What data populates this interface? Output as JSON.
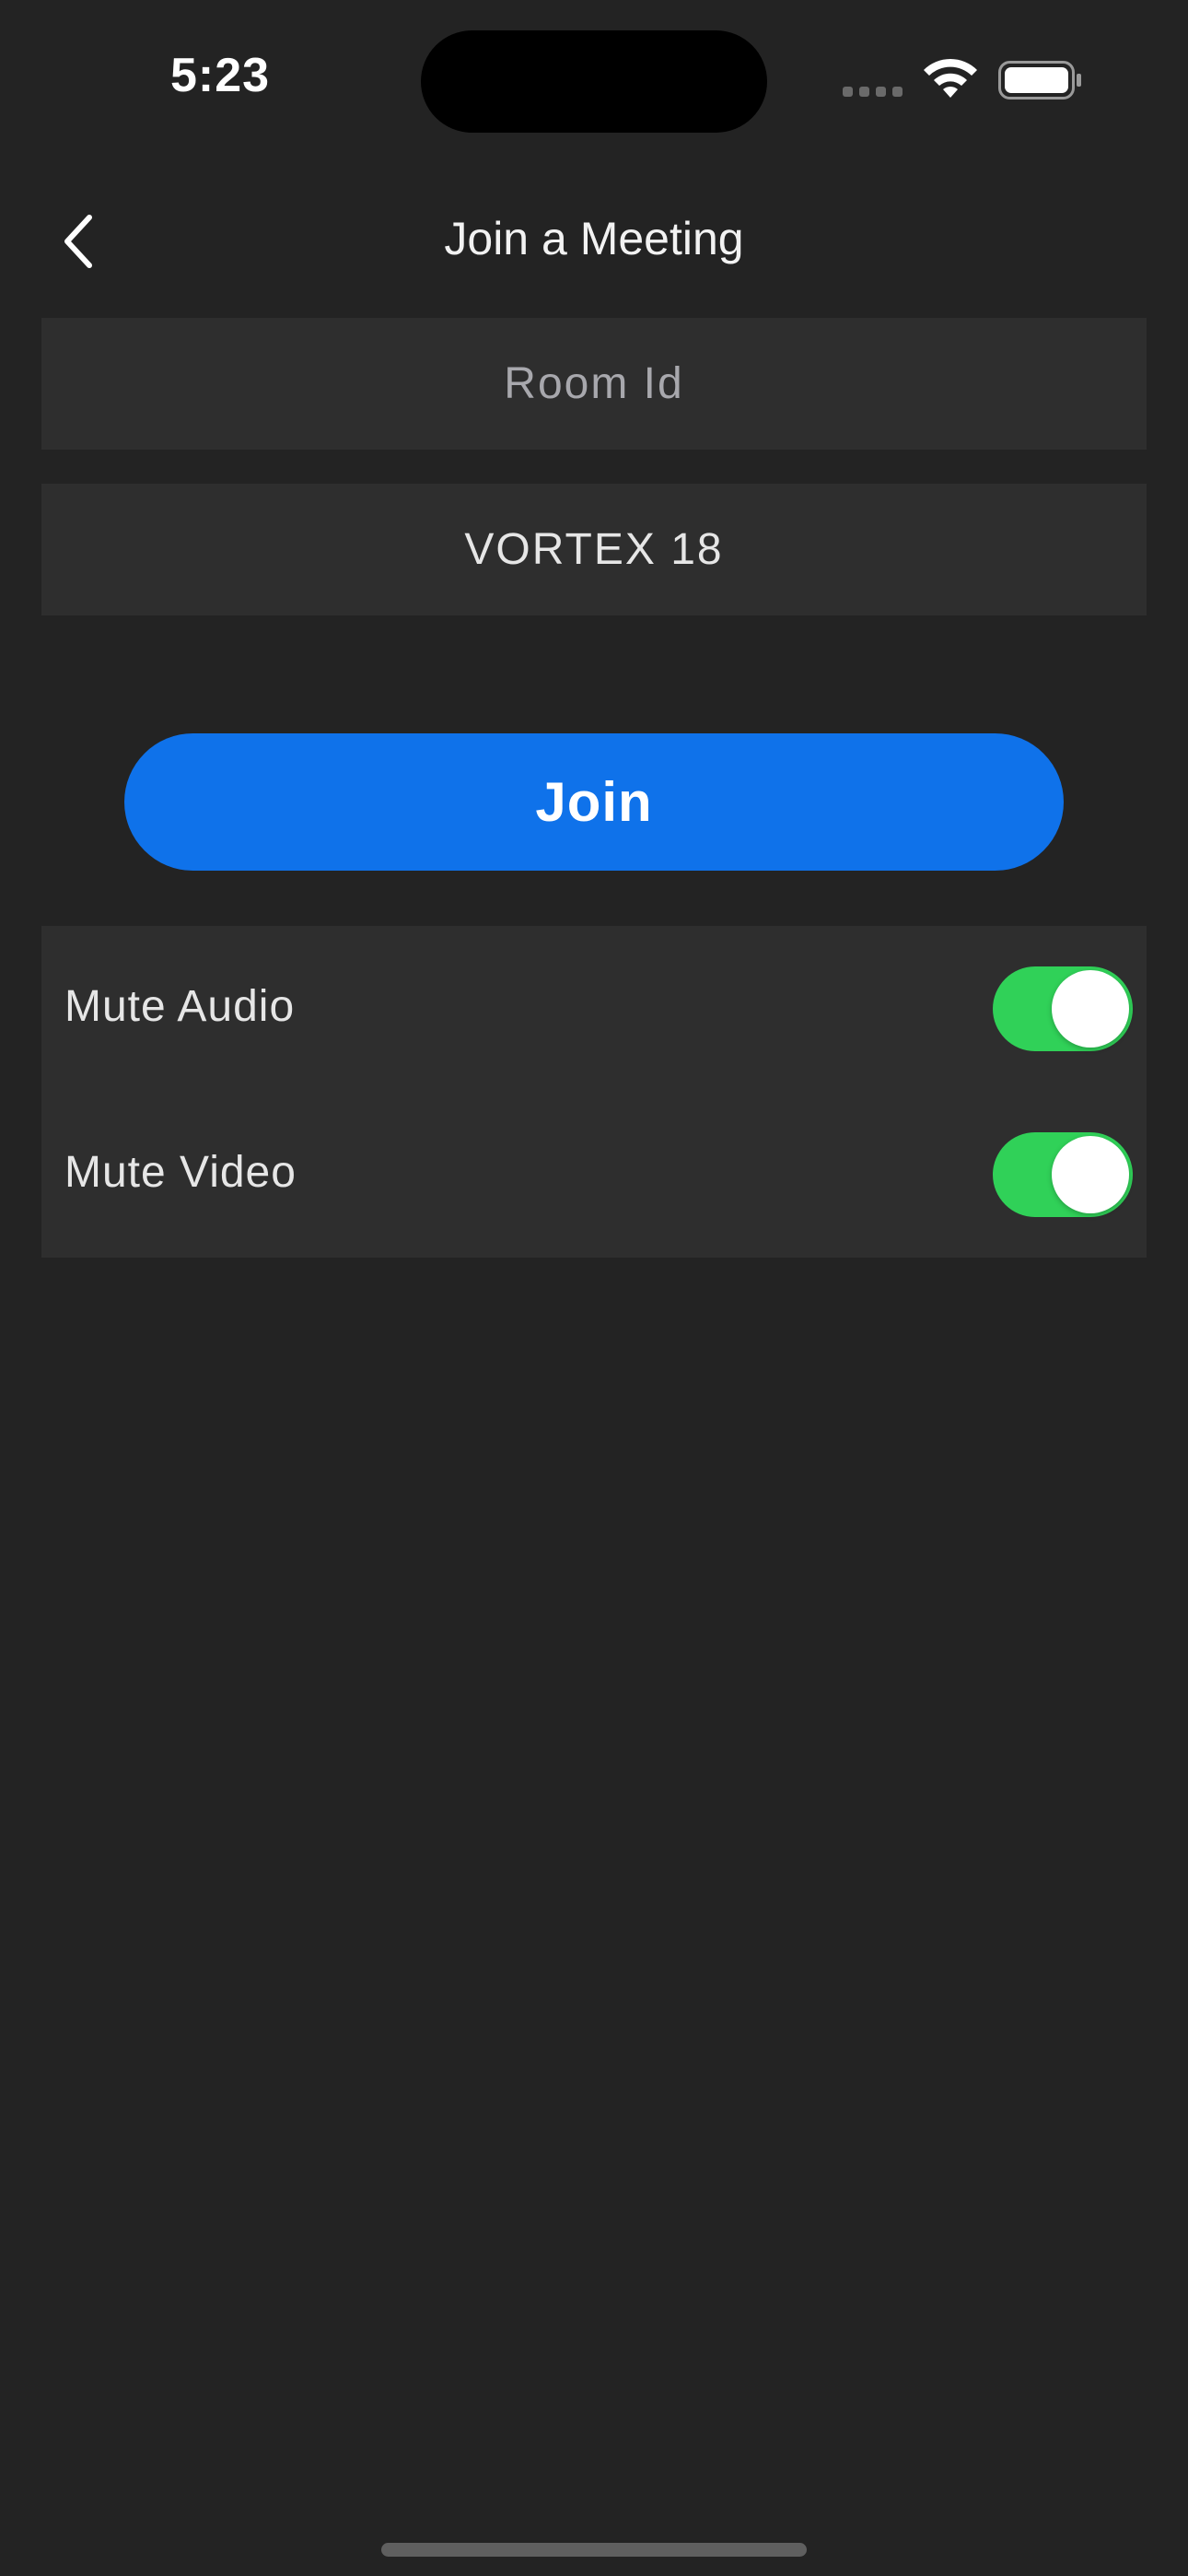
{
  "status_bar": {
    "time": "5:23",
    "icons": [
      "cellular-signal-icon",
      "wifi-icon",
      "battery-icon"
    ]
  },
  "nav": {
    "title": "Join a Meeting",
    "back_icon": "chevron-left-icon"
  },
  "form": {
    "room_id": {
      "value": "",
      "placeholder": "Room Id"
    },
    "display_name": {
      "value": "VORTEX 18",
      "placeholder": ""
    },
    "join_label": "Join"
  },
  "settings": {
    "mute_audio": {
      "label": "Mute Audio",
      "enabled": true
    },
    "mute_video": {
      "label": "Mute Video",
      "enabled": true
    }
  },
  "colors": {
    "background": "#232323",
    "field_background": "#2e2e2e",
    "accent_blue": "#0f72ea",
    "toggle_on": "#30d158"
  }
}
